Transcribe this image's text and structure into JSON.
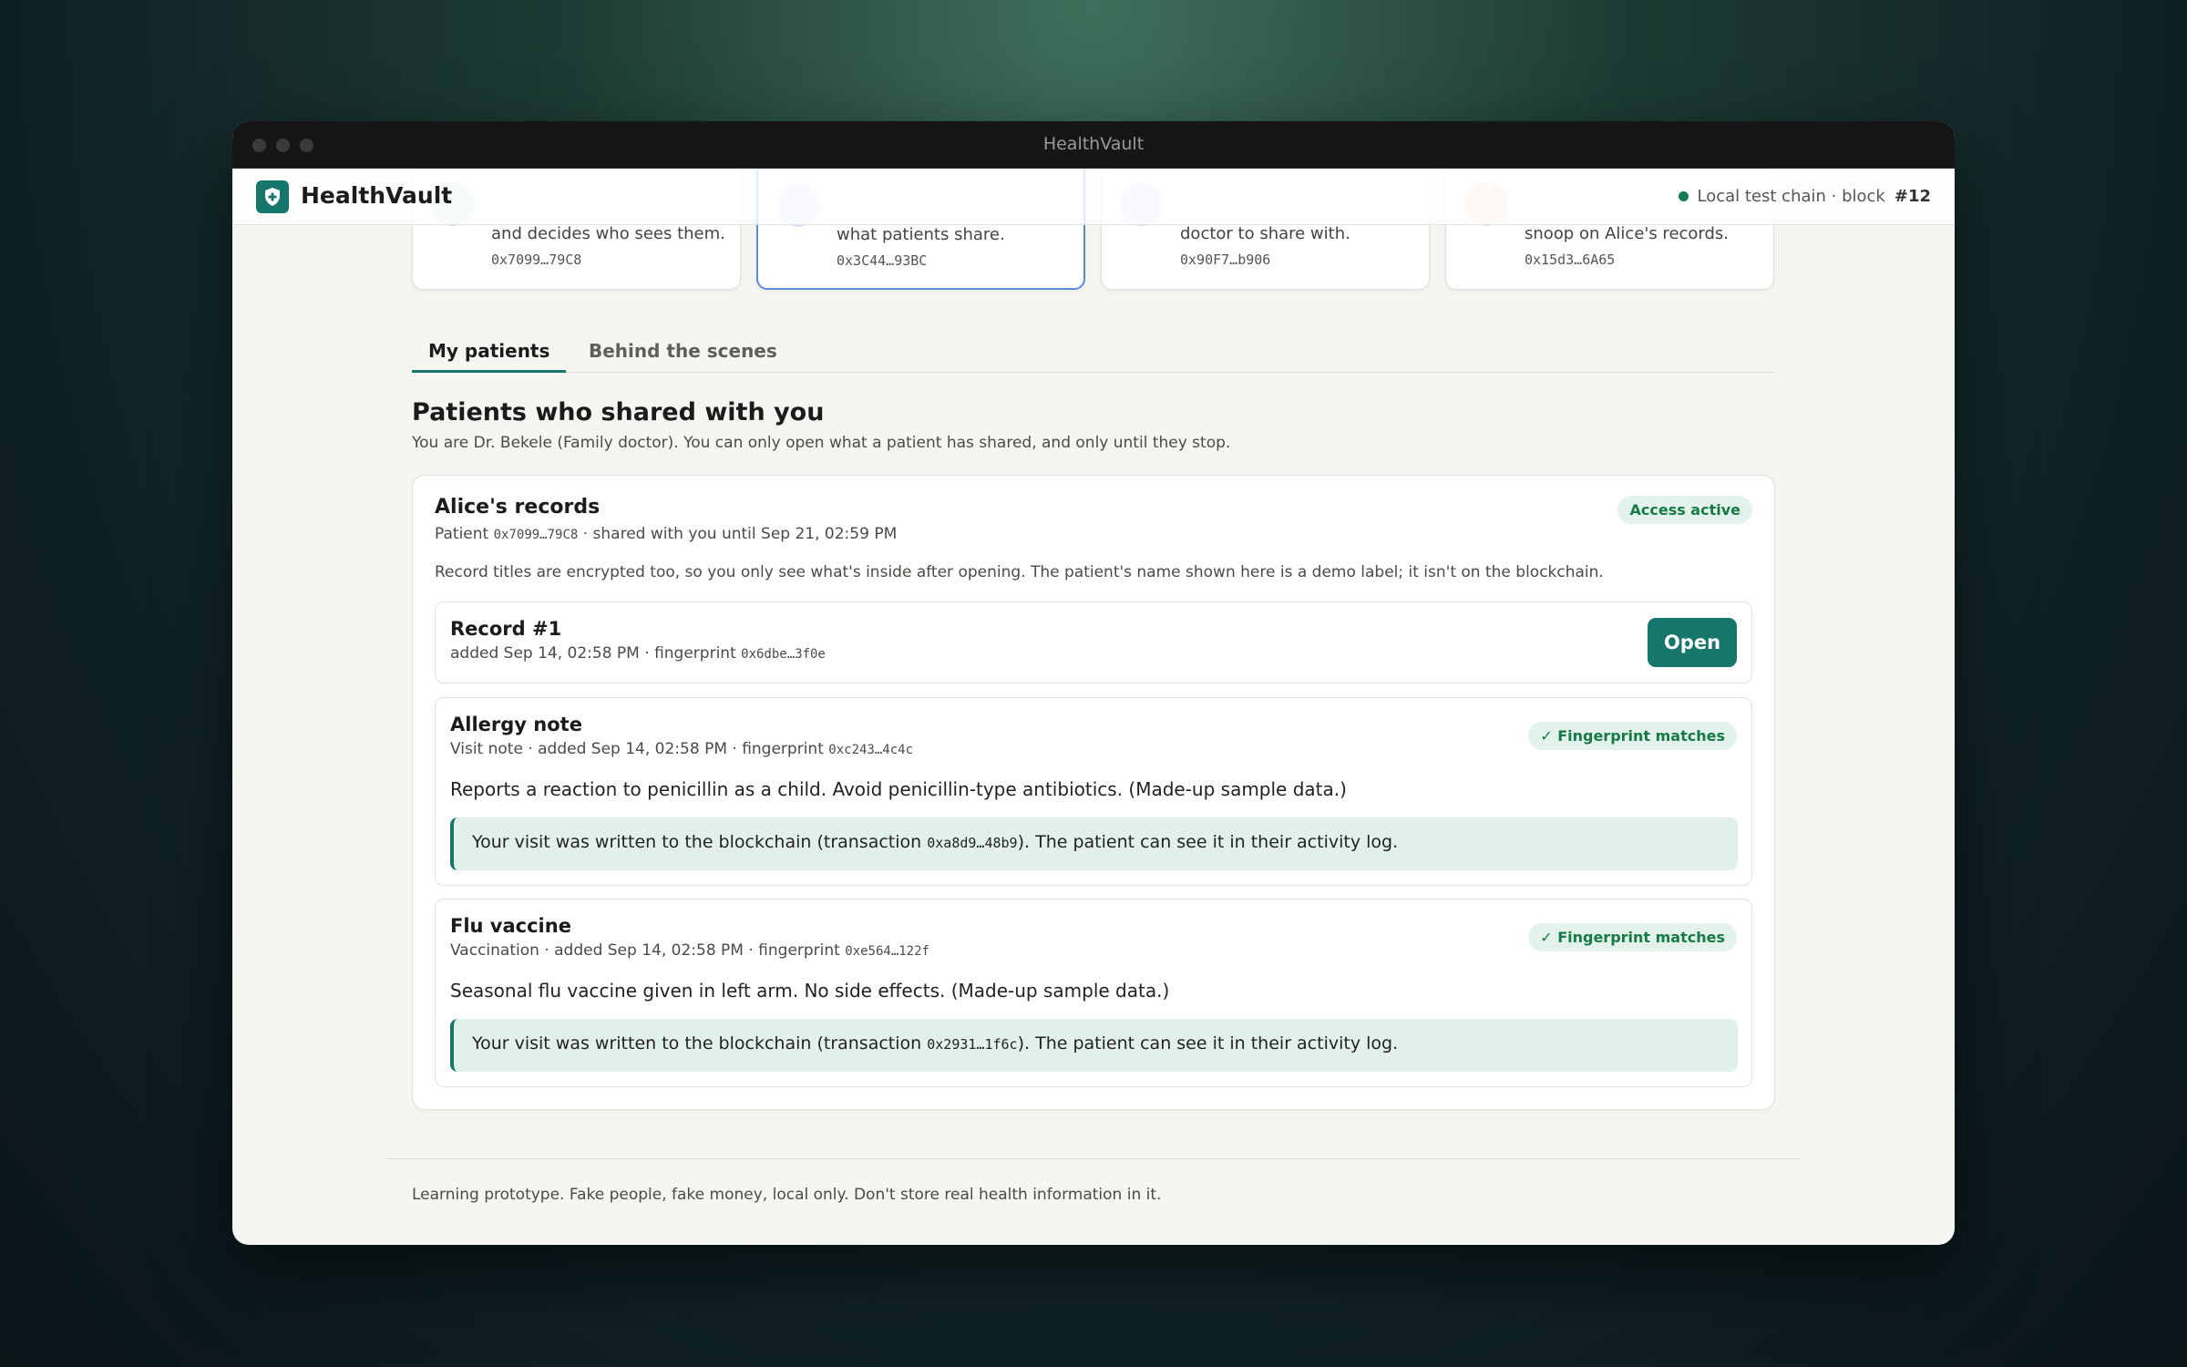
{
  "window": {
    "title": "HealthVault"
  },
  "appbar": {
    "app_name": "HealthVault",
    "logo_icon": "shield-plus-icon",
    "chain_label": "Local test chain · block",
    "block_number": "#12",
    "status_color": "#147a4f"
  },
  "role_cards": [
    {
      "description": "and decides who sees them.",
      "address": "0x7099…79C8",
      "avatar_color": "#cfe6dd"
    },
    {
      "description": "what patients share.",
      "address": "0x3C44…93BC",
      "avatar_color": "#d6e1f5"
    },
    {
      "description": "doctor to share with.",
      "address": "0x90F7…b906",
      "avatar_color": "#e4dbf4"
    },
    {
      "description": "snoop on Alice's records.",
      "address": "0x15d3…6A65",
      "avatar_color": "#f6ddd3"
    }
  ],
  "tabs": [
    {
      "label": "My patients",
      "active": true
    },
    {
      "label": "Behind the scenes",
      "active": false
    }
  ],
  "section": {
    "title": "Patients who shared with you",
    "subtitle": "You are Dr. Bekele (Family doctor). You can only open what a patient has shared, and only until they stop."
  },
  "patient": {
    "title": "Alice's records",
    "meta_prefix": "Patient",
    "address": "0x7099…79C8",
    "meta_suffix": "· shared with you until Sep 21, 02:59 PM",
    "badge": "Access active",
    "note": "Record titles are encrypted too, so you only see what's inside after opening. The patient's name shown here is a demo label; it isn't on the blockchain."
  },
  "records": [
    {
      "title": "Record #1",
      "meta": "added Sep 14, 02:58 PM · fingerprint",
      "fingerprint": "0x6dbe…3f0e",
      "button": "Open"
    },
    {
      "title": "Allergy note",
      "meta": "Visit note · added Sep 14, 02:58 PM · fingerprint",
      "fingerprint": "0xc243…4c4c",
      "badge": "✓ Fingerprint matches",
      "body": "Reports a reaction to penicillin as a child. Avoid penicillin-type antibiotics. (Made-up sample data.)",
      "tx_prefix": "Your visit was written to the blockchain (transaction",
      "tx_hash": "0xa8d9…48b9",
      "tx_suffix": "). The patient can see it in their activity log."
    },
    {
      "title": "Flu vaccine",
      "meta": "Vaccination · added Sep 14, 02:58 PM · fingerprint",
      "fingerprint": "0xe564…122f",
      "badge": "✓ Fingerprint matches",
      "body": "Seasonal flu vaccine given in left arm. No side effects. (Made-up sample data.)",
      "tx_prefix": "Your visit was written to the blockchain (transaction",
      "tx_hash": "0x2931…1f6c",
      "tx_suffix": "). The patient can see it in their activity log."
    }
  ],
  "footer": {
    "text": "Learning prototype. Fake people, fake money, local only. Don't store real health information in it."
  },
  "colors": {
    "accent": "#17766b",
    "badge_bg": "#e3f2ea",
    "badge_text": "#157a45",
    "selected_card_border": "#5b8ad8"
  }
}
